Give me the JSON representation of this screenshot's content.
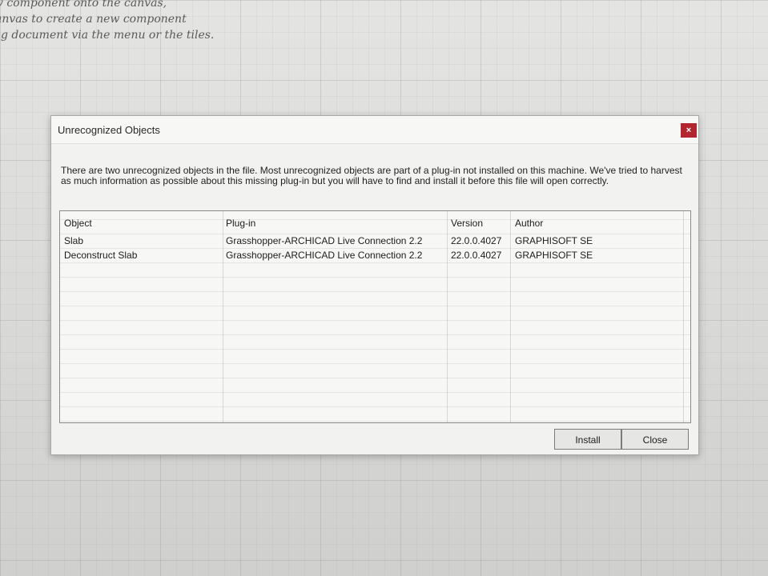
{
  "canvas_hints": [
    "v component onto the canvas,",
    "anvas to create a new component",
    "ng document via the menu or the tiles."
  ],
  "dialog": {
    "title": "Unrecognized Objects",
    "close_label": "×",
    "message_line1": "There are two unrecognized objects in the file. Most unrecognized objects are part of a plug-in not installed on this machine. We've tried to harvest",
    "message_line2": "as much information as possible about this missing plug-in but you will have to find and install it before this file will open correctly.",
    "table": {
      "columns": [
        "Object",
        "Plug-in",
        "Version",
        "Author"
      ],
      "rows": [
        [
          "Slab",
          "Grasshopper-ARCHICAD Live Connection 2.2",
          "22.0.0.4027",
          "GRAPHISOFT SE"
        ],
        [
          "Deconstruct Slab",
          "Grasshopper-ARCHICAD Live Connection 2.2",
          "22.0.0.4027",
          "GRAPHISOFT SE"
        ]
      ]
    },
    "buttons": {
      "install": "Install",
      "close": "Close"
    }
  },
  "colors": {
    "close_button": "#b3242e",
    "dialog_background": "#f2f2f0",
    "canvas_background": "#dcdcda"
  }
}
